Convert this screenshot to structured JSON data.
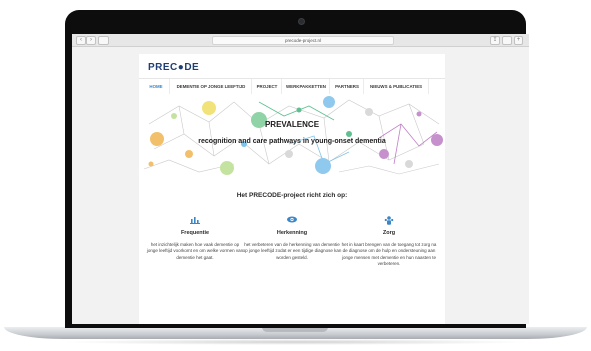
{
  "browser": {
    "url": "precode-project.nl"
  },
  "site": {
    "logo": "PREC●DE",
    "menu": [
      "HOME",
      "DEMENTIE OP JONGE LEEFTIJD",
      "PROJECT",
      "WERKPAKKETTEN",
      "PARTNERS",
      "NIEUWS & PUBLICATIES"
    ],
    "hero": {
      "title": "PREVALENCE",
      "subtitle": "recognition and care pathways in young-onset dementia"
    },
    "section_title": "Het PRECODE-project richt zich op:",
    "features": [
      {
        "icon": "bar-chart-icon",
        "title": "Frequentie",
        "text": "het inzichtelijk maken hoe vaak dementie op jonge leeftijd voorkomt en om welke vormen van dementie het gaat."
      },
      {
        "icon": "eye-icon",
        "title": "Herkenning",
        "text": "het verbeteren van de herkenning van dementie op jonge leeftijd zodat er een tijdige diagnose kan worden gesteld."
      },
      {
        "icon": "people-icon",
        "title": "Zorg",
        "text": "het in kaart brengen van de toegang tot zorg na de diagnose om de hulp en ondersteuning aan jonge mensen met dementie en hun naasten te verbeteren."
      }
    ]
  },
  "colors": {
    "accent": "#3a86c7",
    "brand": "#1f3e73"
  }
}
